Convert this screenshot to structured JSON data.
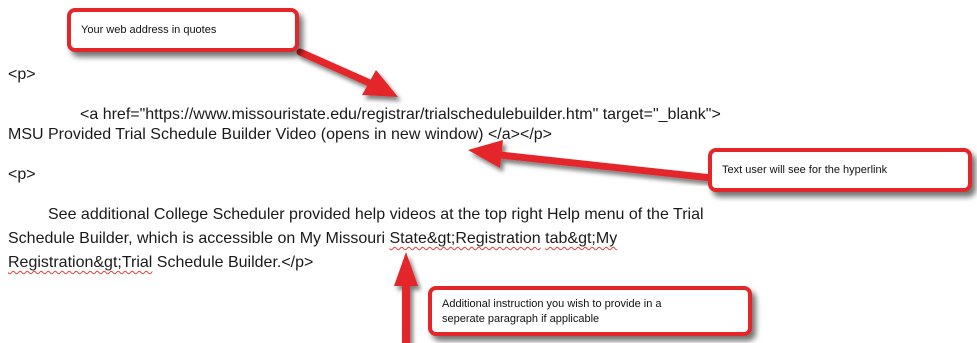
{
  "document": {
    "p_open_1": "<p>",
    "anchor_line": "<a href=\"https://www.missouristate.edu/registrar/trialschedulebuilder.htm\" target=\"_blank\">",
    "link_text_line": "MSU Provided Trial Schedule Builder Video (opens in new window) </a></p>",
    "p_open_2": "<p>",
    "para_line_1": "See additional College Scheduler provided help videos at the top right Help menu of the Trial",
    "para_line_2_a": "Schedule Builder, which is accessible on My Missouri ",
    "para_line_2_b": "State&gt;Registration",
    "para_line_2_c": " ",
    "para_line_2_d": "tab&gt;My",
    "para_line_3_a": "Registration&gt;Trial",
    "para_line_3_b": " Schedule Builder.</p>"
  },
  "callouts": {
    "web_address": "Your web address in quotes",
    "link_text": "Text user will see for the hyperlink",
    "additional_line_1": "Additional instruction you wish to provide in a",
    "additional_line_2": "seperate paragraph if applicable"
  },
  "colors": {
    "callout_border": "#e4262b",
    "arrow": "#e4262b",
    "spellcheck": "#e0403a"
  }
}
